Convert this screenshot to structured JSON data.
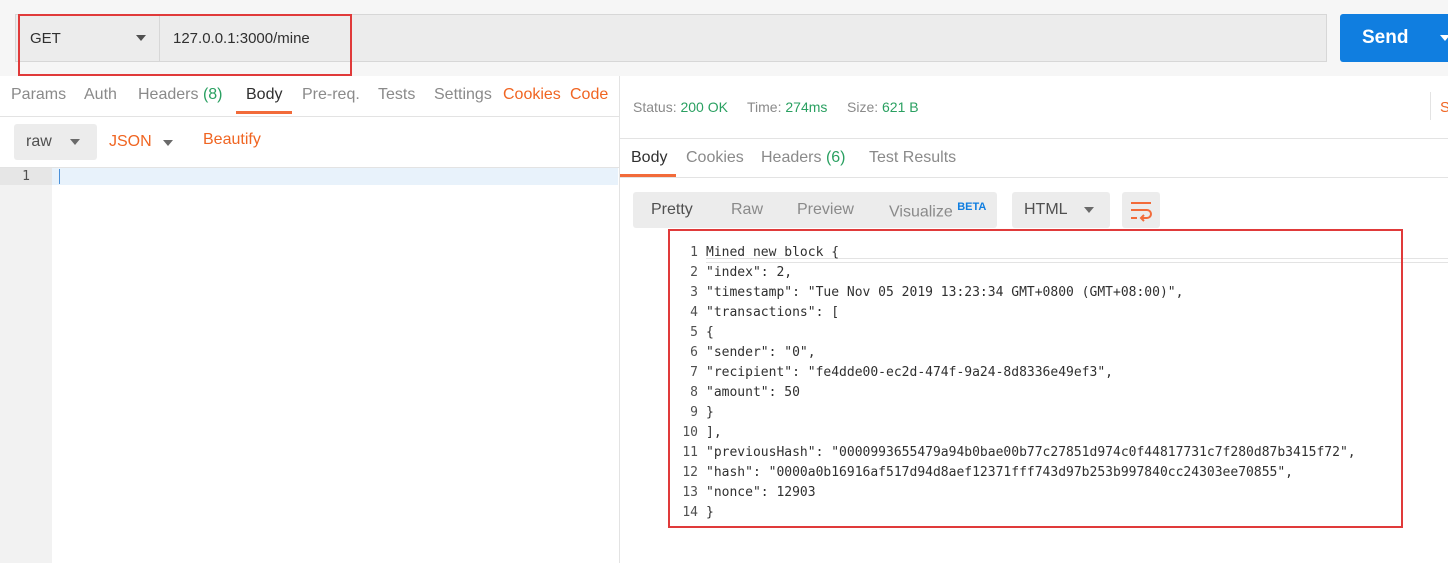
{
  "request": {
    "method": "GET",
    "url": "127.0.0.1:3000/mine",
    "send_label": "Send"
  },
  "req_tabs": [
    {
      "label": "Params"
    },
    {
      "label": "Auth"
    },
    {
      "label": "Headers",
      "count": "(8)"
    },
    {
      "label": "Body"
    },
    {
      "label": "Pre-req."
    },
    {
      "label": "Tests"
    },
    {
      "label": "Settings"
    }
  ],
  "req_links": {
    "cookies": "Cookies",
    "code": "Code"
  },
  "body_options": {
    "mode": "raw",
    "format": "JSON",
    "beautify": "Beautify"
  },
  "editor": {
    "line": "1"
  },
  "status": {
    "status_label": "Status:",
    "status_value": "200 OK",
    "time_label": "Time:",
    "time_value": "274ms",
    "size_label": "Size:",
    "size_value": "621 B",
    "clipped": "S"
  },
  "resp_tabs": [
    {
      "label": "Body"
    },
    {
      "label": "Cookies"
    },
    {
      "label": "Headers",
      "count": "(6)"
    },
    {
      "label": "Test Results"
    }
  ],
  "view_tabs": {
    "pretty": "Pretty",
    "raw": "Raw",
    "preview": "Preview",
    "visualize": "Visualize",
    "beta": "BETA",
    "format": "HTML"
  },
  "response_lines": [
    {
      "n": "1",
      "t": "Mined new block {"
    },
    {
      "n": "2",
      "t": "\"index\": 2,"
    },
    {
      "n": "3",
      "t": "\"timestamp\": \"Tue Nov 05 2019 13:23:34 GMT+0800 (GMT+08:00)\","
    },
    {
      "n": "4",
      "t": "\"transactions\": ["
    },
    {
      "n": "5",
      "t": "{"
    },
    {
      "n": "6",
      "t": "\"sender\": \"0\","
    },
    {
      "n": "7",
      "t": "\"recipient\": \"fe4dde00-ec2d-474f-9a24-8d8336e49ef3\","
    },
    {
      "n": "8",
      "t": "\"amount\": 50"
    },
    {
      "n": "9",
      "t": "}"
    },
    {
      "n": "10",
      "t": "],"
    },
    {
      "n": "11",
      "t": "\"previousHash\": \"0000993655479a94b0bae00b77c27851d974c0f44817731c7f280d87b3415f72\","
    },
    {
      "n": "12",
      "t": "\"hash\": \"0000a0b16916af517d94d8aef12371fff743d97b253b997840cc24303ee70855\","
    },
    {
      "n": "13",
      "t": "\"nonce\": 12903"
    },
    {
      "n": "14",
      "t": "}"
    }
  ],
  "colors": {
    "accent": "#f26b3a",
    "send": "#107ee0",
    "success": "#2aa061",
    "highlight": "#e03a3a"
  }
}
